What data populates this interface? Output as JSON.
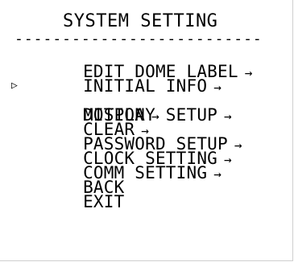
{
  "menu": {
    "title": "SYSTEM SETTING",
    "divider": "--------------------------",
    "cursor": "▷",
    "arrow": "→",
    "items": [
      {
        "label": "EDIT DOME LABEL",
        "has_submenu": true,
        "selected": false
      },
      {
        "label": "INITIAL INFO",
        "has_submenu": true,
        "selected": false
      },
      {
        "label": "DISPLAY SETUP",
        "has_submenu": true,
        "selected": true
      },
      {
        "label": "MOTION",
        "has_submenu": true,
        "selected": false
      },
      {
        "label": "CLEAR",
        "has_submenu": true,
        "selected": false
      },
      {
        "label": "PASSWORD SETUP",
        "has_submenu": true,
        "selected": false
      },
      {
        "label": "CLOCK SETTING",
        "has_submenu": true,
        "selected": false
      },
      {
        "label": "COMM SETTING",
        "has_submenu": true,
        "selected": false
      },
      {
        "label": "BACK",
        "has_submenu": false,
        "selected": false
      },
      {
        "label": "EXIT",
        "has_submenu": false,
        "selected": false
      }
    ]
  }
}
